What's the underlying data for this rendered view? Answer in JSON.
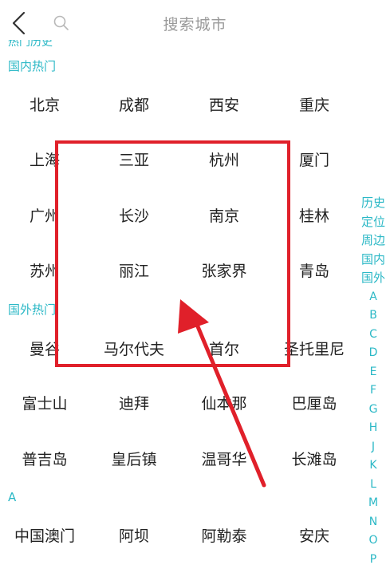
{
  "header": {
    "title": "搜索城市"
  },
  "sections": {
    "partial_hidden_label": "热门历史",
    "domestic_hot": "国内热门",
    "foreign_hot": "国外热门",
    "letter_a": "A"
  },
  "domestic_cities": [
    [
      "北京",
      "成都",
      "西安",
      "重庆"
    ],
    [
      "上海",
      "三亚",
      "杭州",
      "厦门"
    ],
    [
      "广州",
      "长沙",
      "南京",
      "桂林"
    ],
    [
      "苏州",
      "丽江",
      "张家界",
      "青岛"
    ]
  ],
  "foreign_cities": [
    [
      "曼谷",
      "马尔代夫",
      "首尔",
      "圣托里尼"
    ],
    [
      "富士山",
      "迪拜",
      "仙本那",
      "巴厘岛"
    ],
    [
      "普吉岛",
      "皇后镇",
      "温哥华",
      "长滩岛"
    ]
  ],
  "letter_a_cities": [
    "中国澳门",
    "阿坝",
    "阿勒泰",
    "安庆"
  ],
  "index_bar": {
    "items": [
      "历史",
      "定位",
      "周边",
      "国内",
      "国外"
    ],
    "letters": [
      "A",
      "B",
      "C",
      "D",
      "E",
      "F",
      "G",
      "H",
      "J",
      "K",
      "L",
      "M",
      "N",
      "O",
      "P"
    ]
  },
  "colors": {
    "accent": "#2bb8c6",
    "annotation": "#e0202a",
    "text": "#222222",
    "title": "#9a9a9a"
  }
}
